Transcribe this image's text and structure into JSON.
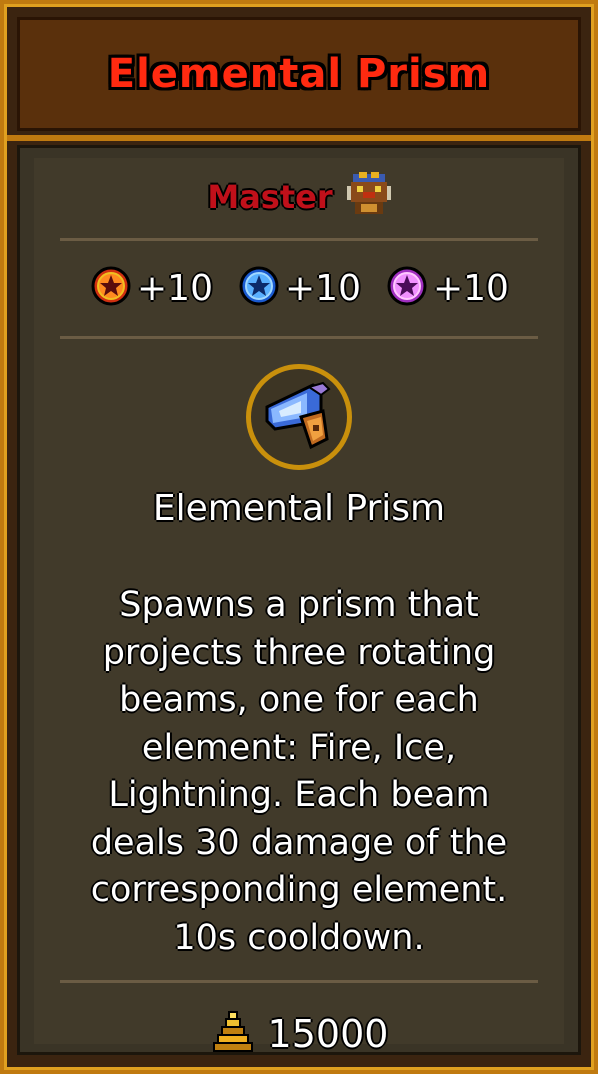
{
  "header": {
    "title": "Elemental Prism"
  },
  "rank": {
    "label": "Master",
    "icon": "master-rank-icon"
  },
  "stats": [
    {
      "icon": "fire-element-icon",
      "value": "+10",
      "color": "#ff7a10"
    },
    {
      "icon": "ice-element-icon",
      "value": "+10",
      "color": "#3aa0ff"
    },
    {
      "icon": "lightning-element-icon",
      "value": "+10",
      "color": "#e070ff"
    }
  ],
  "item": {
    "icon": "prism-icon",
    "name": "Elemental Prism",
    "description_lines": [
      "Spawns a prism that",
      "projects three rotating",
      "beams, one for each",
      "element: Fire, Ice,",
      "Lightning. Each beam",
      "deals 30 damage of the",
      "corresponding element.",
      "10s cooldown."
    ]
  },
  "cost": {
    "icon": "gold-coins-icon",
    "value": "15000"
  },
  "colors": {
    "frame": "#c07a10",
    "title": "#ff2a10",
    "rank": "#c0101a",
    "panel": "#413a2a"
  }
}
